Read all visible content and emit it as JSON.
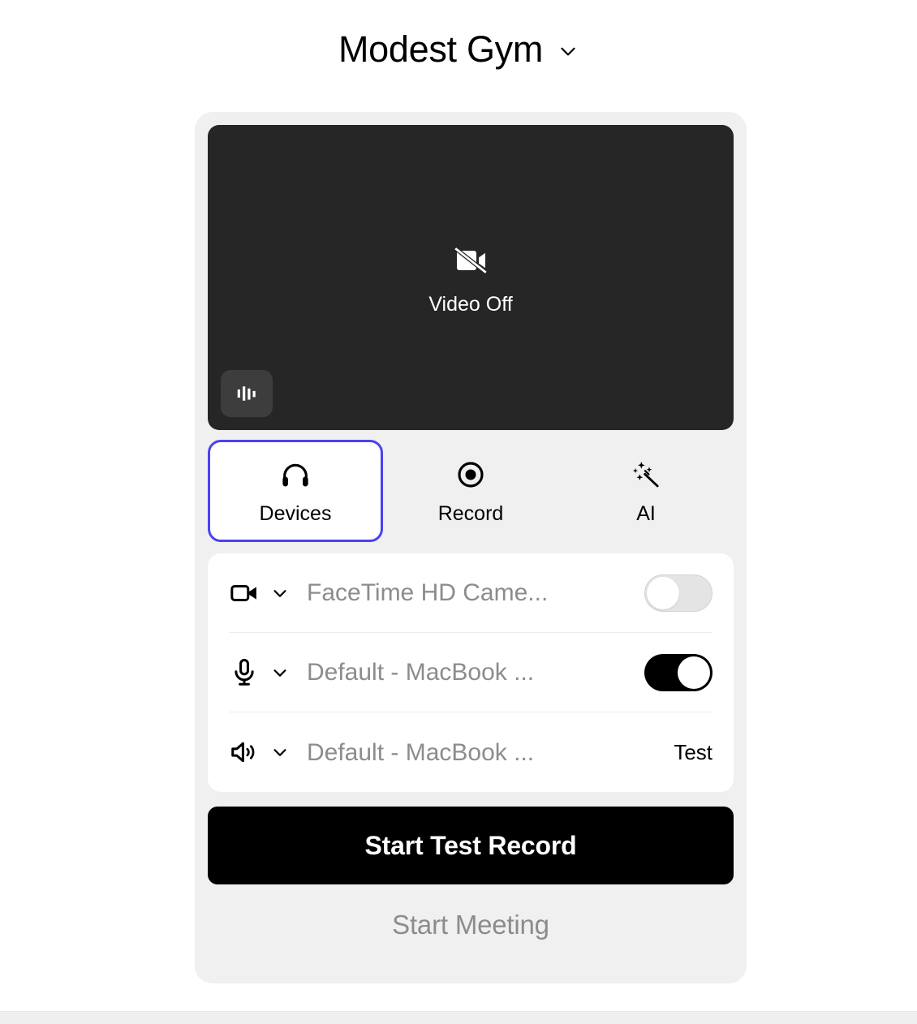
{
  "header": {
    "title": "Modest Gym",
    "dropdown_icon": "chevron-down-icon"
  },
  "video_preview": {
    "status_label": "Video Off",
    "status_icon": "video-off-icon",
    "audio_level_icon": "audio-waveform-icon",
    "background_color": "#262626"
  },
  "tabs": [
    {
      "label": "Devices",
      "icon": "headphones-icon",
      "selected": true
    },
    {
      "label": "Record",
      "icon": "record-circle-icon",
      "selected": false
    },
    {
      "label": "AI",
      "icon": "magic-wand-sparkles-icon",
      "selected": false
    }
  ],
  "selected_tab_border_color": "#4B41F2",
  "devices": [
    {
      "icon": "video-camera-icon",
      "chevron_icon": "chevron-down-icon",
      "name": "FaceTime HD Came...",
      "control": "toggle",
      "toggle_on": false
    },
    {
      "icon": "microphone-icon",
      "chevron_icon": "chevron-down-icon",
      "name": "Default - MacBook ...",
      "control": "toggle",
      "toggle_on": true
    },
    {
      "icon": "speaker-icon",
      "chevron_icon": "chevron-down-icon",
      "name": "Default - MacBook ...",
      "control": "button",
      "button_label": "Test"
    }
  ],
  "actions": {
    "primary_label": "Start Test Record",
    "secondary_label": "Start Meeting"
  }
}
